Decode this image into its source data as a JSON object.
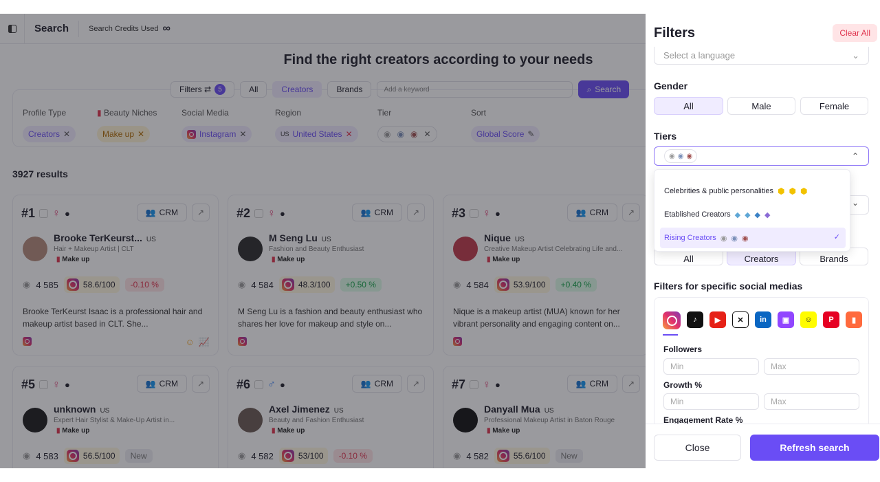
{
  "topbar": {
    "title": "Search",
    "credits_label": "Search Credits Used",
    "credits_value": "∞"
  },
  "main_title": "Find the right creators according to your needs",
  "search": {
    "filters_label": "Filters",
    "filters_count": "5",
    "tabs": [
      "All",
      "Creators",
      "Brands"
    ],
    "keyword_placeholder": "Add a keyword",
    "search_button": "Search"
  },
  "filterbar": {
    "profile_type": {
      "label": "Profile Type",
      "value": "Creators"
    },
    "beauty_niches": {
      "label": "Beauty Niches",
      "value": "Make up"
    },
    "social_media": {
      "label": "Social Media",
      "value": "Instagram"
    },
    "region": {
      "label": "Region",
      "code": "US",
      "value": "United States"
    },
    "tier": {
      "label": "Tier"
    },
    "sort": {
      "label": "Sort",
      "value": "Global Score"
    }
  },
  "results_count": "3927 results",
  "cards": [
    {
      "rank": "#1",
      "gender": "♀",
      "crm": "CRM",
      "name": "Brooke TerKeurst...",
      "country": "US",
      "bio": "Hair + Makeup Artist | CLT",
      "niche": "Make up",
      "tier_score": "4 585",
      "ig_score": "58.6/100",
      "growth": "-0.10 %",
      "growth_type": "neg",
      "desc": "Brooke TerKeurst Isaac is a professional hair and makeup artist based in CLT. She...",
      "avatar_color": "#b48a7a"
    },
    {
      "rank": "#2",
      "gender": "♀",
      "crm": "CRM",
      "name": "M Seng Lu",
      "country": "US",
      "bio": "Fashion and Beauty Enthusiast",
      "niche": "Make up",
      "tier_score": "4 584",
      "ig_score": "48.3/100",
      "growth": "+0.50 %",
      "growth_type": "pos",
      "desc": "M Seng Lu is a fashion and beauty enthusiast who shares her love for makeup and style on...",
      "avatar_color": "#2a2a2a"
    },
    {
      "rank": "#3",
      "gender": "♀",
      "crm": "CRM",
      "name": "Nique",
      "country": "US",
      "bio": "Creative Makeup Artist Celebrating Life and...",
      "niche": "Make up",
      "tier_score": "4 584",
      "ig_score": "53.9/100",
      "growth": "+0.40 %",
      "growth_type": "pos",
      "desc": "Nique is a makeup artist (MUA) known for her vibrant personality and engaging content on...",
      "avatar_color": "#c03a4a"
    },
    {
      "rank": "#5",
      "gender": "♀",
      "crm": "CRM",
      "name": "unknown",
      "country": "US",
      "bio": "Expert Hair Stylist & Make-Up Artist in...",
      "niche": "Make up",
      "tier_score": "4 583",
      "ig_score": "56.5/100",
      "growth": "New",
      "growth_type": "new",
      "avatar_color": "#1a1a1a"
    },
    {
      "rank": "#6",
      "gender": "♂",
      "crm": "CRM",
      "name": "Axel Jimenez",
      "country": "US",
      "bio": "Beauty and Fashion Enthusiast",
      "niche": "Make up",
      "tier_score": "4 582",
      "ig_score": "53/100",
      "growth": "-0.10 %",
      "growth_type": "neg",
      "avatar_color": "#6b5a52"
    },
    {
      "rank": "#7",
      "gender": "♀",
      "crm": "CRM",
      "name": "Danyall Mua",
      "country": "US",
      "bio": "Professional Makeup Artist in Baton Rouge",
      "niche": "Make up",
      "tier_score": "4 582",
      "ig_score": "55.6/100",
      "growth": "New",
      "growth_type": "new",
      "avatar_color": "#111111"
    }
  ],
  "panel": {
    "title": "Filters",
    "clear_all": "Clear All",
    "language_placeholder": "Select a language",
    "gender_label": "Gender",
    "gender_options": [
      "All",
      "Male",
      "Female"
    ],
    "tiers_label": "Tiers",
    "tier_options": [
      "Celebrities & public personalities",
      "Etablished Creators",
      "Rising Creators"
    ],
    "profile_options": [
      "All",
      "Creators",
      "Brands"
    ],
    "social_section": "Filters for specific social medias",
    "followers_label": "Followers",
    "growth_label": "Growth %",
    "engagement_label": "Engagement Rate %",
    "min_placeholder": "Min",
    "max_placeholder": "Max",
    "close": "Close",
    "refresh": "Refresh search"
  }
}
